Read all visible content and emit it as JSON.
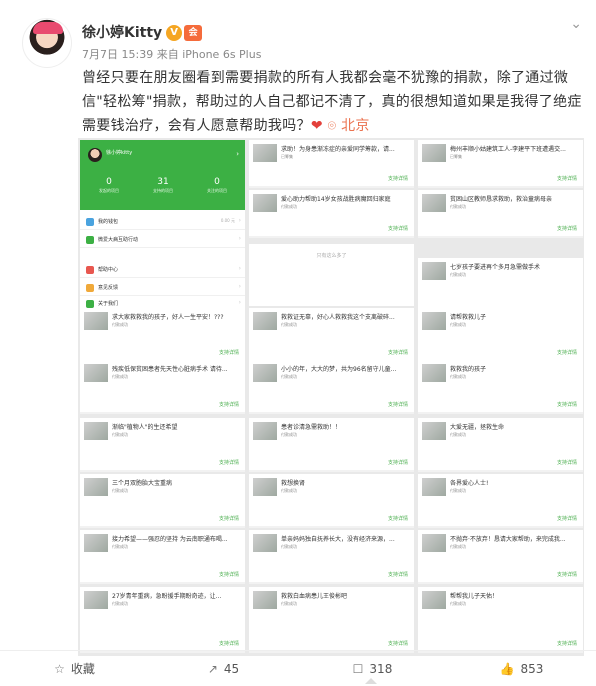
{
  "post": {
    "author": "徐小婷Kitty",
    "verified_badge": "V",
    "vip_badge": "会",
    "time": "7月7日 15:39",
    "source": "来自 iPhone 6s Plus",
    "text": "曾经只要在朋友圈看到需要捐款的所有人我都会毫不犹豫的捐款，除了通过微信\"轻松筹\"捐款，帮助过的人自己都记不清了，真的很想知道如果是我得了绝症需要钱治疗，会有人愿意帮助我吗？",
    "heart": "❤",
    "location_icon": "location-pin-icon",
    "location": "北京"
  },
  "app": {
    "username": "徐小婷kitty",
    "stats": [
      {
        "value": "0",
        "label": "发起的项目"
      },
      {
        "value": "31",
        "label": "支持的项目"
      },
      {
        "value": "0",
        "label": "关注的项目"
      }
    ],
    "menu": [
      {
        "label": "我的钱包",
        "right": "0.00 元",
        "color": "#4aa3df"
      },
      {
        "label": "微爱大病互助行动",
        "right": "",
        "color": "#3cb044"
      },
      {
        "label": "帮助中心",
        "right": "",
        "color": "#e8574f"
      },
      {
        "label": "意见反馈",
        "right": "",
        "color": "#f0a93a"
      },
      {
        "label": "关于我们",
        "right": "",
        "color": "#3cb044"
      }
    ]
  },
  "cards": [
    {
      "title": "求助！为身患渐冻症的亲爱同学筹款，请...",
      "sub": "已筹集",
      "btn": "支持详情"
    },
    {
      "title": "梅州丰顺小姑建筑工人-李建平下班遭遇交...",
      "sub": "已筹集",
      "btn": "支持详情"
    },
    {
      "title": "爱心助力帮助14岁女孩战胜病魔回归家庭",
      "sub": "付款成功",
      "btn": "支持详情"
    },
    {
      "title": "贫困山区教师恳求救助，救治童病母亲",
      "sub": "付款成功",
      "btn": "支持详情"
    },
    {
      "title": "七岁孩子要进再个多月急需做手术",
      "sub": "付款成功",
      "btn": ""
    },
    {
      "title": "求大家救救我的孩子，好人一生平安！???",
      "sub": "付款成功",
      "btn": "支持详情"
    },
    {
      "title": "救救证无辜，好心人救救我这个支离破碎...",
      "sub": "付款成功",
      "btn": "支持详情"
    },
    {
      "title": "请帮救救儿子",
      "sub": "付款成功",
      "btn": "支持详情"
    },
    {
      "title": "残疾低保贫困患者先天性心脏病手术 请待...",
      "sub": "付款成功",
      "btn": "支持详情"
    },
    {
      "title": "小小的年，大大的梦，共为96名留守儿童...",
      "sub": "付款成功",
      "btn": "支持详情"
    },
    {
      "title": "救救我的孩子",
      "sub": "付款成功",
      "btn": "支持详情"
    },
    {
      "title": "渐临\"植物人\"的生还希望",
      "sub": "付款成功",
      "btn": "支持详情"
    },
    {
      "title": "患者诊清急需救助！！",
      "sub": "付款成功",
      "btn": "支持详情"
    },
    {
      "title": "大爱无疆，拯救生命",
      "sub": "付款成功",
      "btn": "支持详情"
    },
    {
      "title": "三个月双胞胎大宝重病",
      "sub": "付款成功",
      "btn": "支持详情"
    },
    {
      "title": "救想换肾",
      "sub": "付款成功",
      "btn": "支持详情"
    },
    {
      "title": "各界爱心人士!",
      "sub": "付款成功",
      "btn": "支持详情"
    },
    {
      "title": "接力希望——强忍的坚持 为云南职通布喝...",
      "sub": "付款成功",
      "btn": "支持详情"
    },
    {
      "title": "单亲妈妈独自抚养长大，没有经济来源，...",
      "sub": "付款成功",
      "btn": "支持详情"
    },
    {
      "title": "不抛弃·不放弃！恳请大家帮助，来完成我...",
      "sub": "付款成功",
      "btn": "支持详情"
    },
    {
      "title": "27岁青年重病，急盼援手期盼奇迹，让...",
      "sub": "付款成功",
      "btn": "支持详情"
    },
    {
      "title": "救救白血病患儿王俊彬吧",
      "sub": "付款成功",
      "btn": "支持详情"
    },
    {
      "title": "帮帮我儿子天佑！",
      "sub": "付款成功",
      "btn": "支持详情"
    }
  ],
  "loading_text": "只有这么多了",
  "footer": {
    "favorite_label": "收藏",
    "repost_count": "45",
    "comment_count": "318",
    "like_count": "853"
  }
}
